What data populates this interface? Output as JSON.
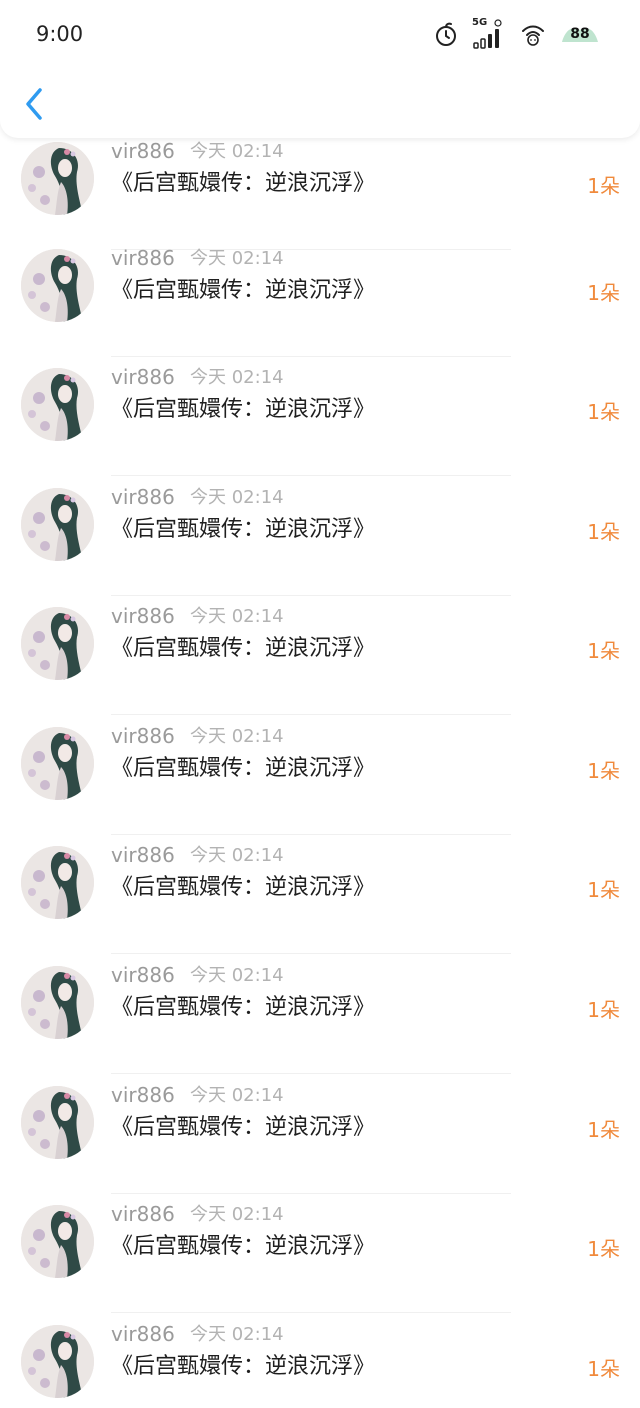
{
  "status_bar": {
    "time": "9:00",
    "network_label": "5G",
    "battery_level": "88",
    "icons": [
      "alarm-icon",
      "cellular-signal-icon",
      "wifi-icon",
      "battery-icon"
    ]
  },
  "nav": {
    "back_icon": "chevron-left-icon"
  },
  "colors": {
    "back_icon": "#2f9bf0",
    "count": "#f08a3c"
  },
  "items": [
    {
      "user": "vir886",
      "time": "今天 02:14",
      "title": "《后宫甄嬛传：逆浪沉浮》",
      "count": "1朵"
    },
    {
      "user": "vir886",
      "time": "今天 02:14",
      "title": "《后宫甄嬛传：逆浪沉浮》",
      "count": "1朵"
    },
    {
      "user": "vir886",
      "time": "今天 02:14",
      "title": "《后宫甄嬛传：逆浪沉浮》",
      "count": "1朵"
    },
    {
      "user": "vir886",
      "time": "今天 02:14",
      "title": "《后宫甄嬛传：逆浪沉浮》",
      "count": "1朵"
    },
    {
      "user": "vir886",
      "time": "今天 02:14",
      "title": "《后宫甄嬛传：逆浪沉浮》",
      "count": "1朵"
    },
    {
      "user": "vir886",
      "time": "今天 02:14",
      "title": "《后宫甄嬛传：逆浪沉浮》",
      "count": "1朵"
    },
    {
      "user": "vir886",
      "time": "今天 02:14",
      "title": "《后宫甄嬛传：逆浪沉浮》",
      "count": "1朵"
    },
    {
      "user": "vir886",
      "time": "今天 02:14",
      "title": "《后宫甄嬛传：逆浪沉浮》",
      "count": "1朵"
    },
    {
      "user": "vir886",
      "time": "今天 02:14",
      "title": "《后宫甄嬛传：逆浪沉浮》",
      "count": "1朵"
    },
    {
      "user": "vir886",
      "time": "今天 02:14",
      "title": "《后宫甄嬛传：逆浪沉浮》",
      "count": "1朵"
    },
    {
      "user": "vir886",
      "time": "今天 02:14",
      "title": "《后宫甄嬛传：逆浪沉浮》",
      "count": "1朵"
    }
  ]
}
